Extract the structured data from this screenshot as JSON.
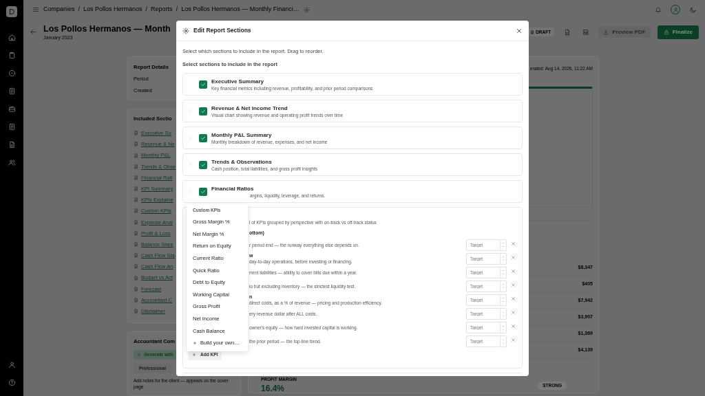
{
  "breadcrumbs": [
    "Companies",
    "Los Pollos Hermanos",
    "Reports",
    "Los Pollos Hermanos — Monthly Financi…"
  ],
  "breadcrumb_separators": [
    "/",
    "/",
    "/"
  ],
  "report": {
    "title": "Los Pollos Hermanos — Month",
    "period": "January 2023"
  },
  "toolbar": {
    "status_badge": "DRAFT",
    "preview_button": "Preview PDF",
    "finalize_button": "Finalize"
  },
  "report_details": {
    "title": "Report Details",
    "fields": [
      "Period",
      "Created"
    ]
  },
  "included_sections": {
    "title": "Included Sectio",
    "links": [
      "Executive Su",
      "Revenue & Ne",
      "Monthly P&L",
      "Trends & Obse",
      "Financial Rati",
      "KPI Summary",
      "KPIs Explaine",
      "Custom KPIs",
      "Expense Anal",
      "Profit & Loss",
      "Balance Shee",
      "Cash Flow Sta",
      "Cash Flow An",
      "Budget vs Act",
      "Forecast",
      "Accountant C",
      "Disclaimer"
    ]
  },
  "accountant_comments": {
    "title": "Accountant Com",
    "generate_button": "Generate with",
    "tabs": [
      {
        "label": "Professional",
        "selected": true
      }
    ],
    "hint": "Add notes for the client — appears on the cover page"
  },
  "report_preview": {
    "generated": "erated: Aug 14, 2026, 11:22 AM",
    "values": [
      "$8,347",
      "$405",
      "$7,942",
      "$3,907",
      "$1,369",
      "$4,139"
    ],
    "metric": {
      "label": "PROFIT MARGIN",
      "value": "16.4%",
      "badge": "STRONG"
    }
  },
  "modal": {
    "title": "Edit Report Sections",
    "intro": "Select which sections to include in the report. Drag to reorder.",
    "list_label": "Select sections to include in the report",
    "sections": [
      {
        "title": "Executive Summary",
        "description": "Key financial metrics including revenue, profitability, and prior period comparisons",
        "checked": true,
        "draggable": false,
        "covered": false
      },
      {
        "title": "Revenue & Net Income Trend",
        "description": "Visual chart showing revenue and operating profit trends over time",
        "checked": true,
        "draggable": true,
        "covered": false
      },
      {
        "title": "Monthly P&L Summary",
        "description": "Monthly breakdown of revenue, expenses, and net income",
        "checked": true,
        "draggable": true,
        "covered": false
      },
      {
        "title": "Trends & Observations",
        "description": "Cash position, total liabilities, and gross profit insights",
        "checked": true,
        "draggable": true,
        "covered": false
      },
      {
        "title": "Financial Ratios",
        "description": "argins, liquidity, leverage, and returns.",
        "checked": true,
        "draggable": true,
        "covered": true
      }
    ],
    "kpi_section": {
      "description": "l of KPIs grouped by perspective with on-track vs off-track status",
      "group_label": "ottom)",
      "add_button": "Add KPI",
      "kpis": [
        {
          "description": "r period end — the runway everything else depends on.",
          "target_placeholder": "Target"
        },
        {
          "title": "w",
          "description": "day-to-day operations, before investing or financing.",
          "target_placeholder": "Target"
        },
        {
          "description": "rrent liabilities — ability to cover bills due within a year.",
          "target_placeholder": "Target"
        },
        {
          "description": "io but excluding inventory — the strictest liquidity test.",
          "target_placeholder": "Target"
        },
        {
          "title": "n",
          "description": "direct costs, as a % of revenue — pricing and production efficiency.",
          "target_placeholder": "Target"
        },
        {
          "description": "ery revenue dollar after ALL costs.",
          "target_placeholder": "Target"
        },
        {
          "description": "owner's equity — how hard invested capital is working.",
          "target_placeholder": "Target"
        },
        {
          "description": "the prior period — the top-line trend.",
          "target_placeholder": "Target"
        }
      ]
    },
    "kpi_menu": {
      "header": "Custom KPIs",
      "items": [
        "Gross Margin %",
        "Net Margin %",
        "Return on Equity",
        "Current Ratio",
        "Quick Ratio",
        "Debt to Equity",
        "Working Capital",
        "Gross Profit",
        "Net Income",
        "Cash Balance"
      ],
      "build_item": "Build your own…"
    }
  }
}
